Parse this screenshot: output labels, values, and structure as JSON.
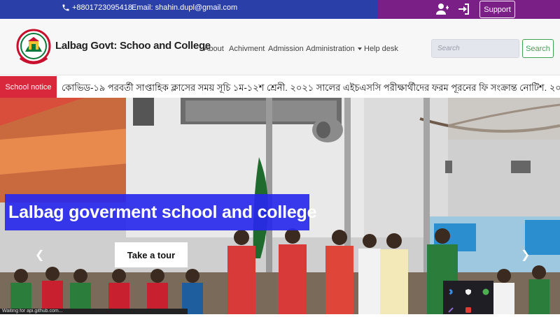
{
  "topbar": {
    "phone": "+8801723095418",
    "email": "Email: shahin.dupl@gmail.com",
    "support_label": "Support",
    "icons": [
      "phone-icon",
      "add-user-icon",
      "sign-in-icon"
    ]
  },
  "navbar": {
    "brand": "Lalbag Govt: Schoo and College",
    "items": [
      "About",
      "Achivment",
      "Admission",
      "Administration",
      "Help desk"
    ],
    "search_placeholder": "Search",
    "search_button": "Search"
  },
  "notice": {
    "label": "School notice",
    "text": "কোভিড-১৯ পরবর্তী সাপ্তাহিক ক্লাসের সময় সূচি ১ম-১২শ শ্রেনী.  ২০২১ সালের এইচএসসি পরীক্ষার্থীদের ফরম পূরনের ফি সংক্রান্ত নোটিশ.  ২০২১ স"
  },
  "hero": {
    "title": "Lalbag goverment school and college",
    "cta": "Take a tour"
  },
  "status_text": "Waiting for api.github.com...",
  "colors": {
    "topbar_blue": "#2b3fa8",
    "topbar_purple": "#7a1f86",
    "notice_red": "#d9283c",
    "hero_title_bg": "#2828eb",
    "search_green": "#3fa156"
  }
}
